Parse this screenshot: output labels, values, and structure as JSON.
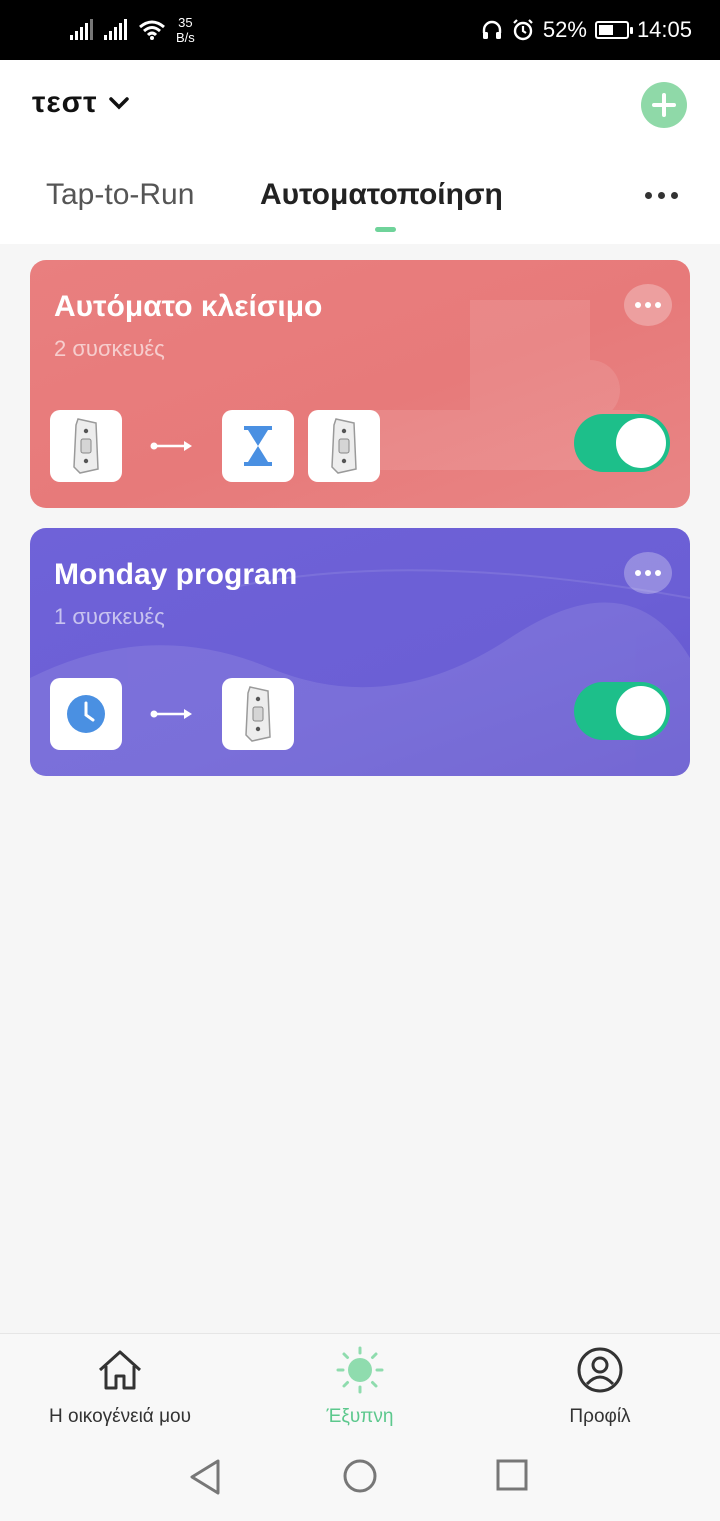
{
  "status_bar": {
    "speed_value": "35",
    "speed_unit": "B/s",
    "battery": "52%",
    "battery_level": 0.52,
    "time": "14:05"
  },
  "header": {
    "home_name": "τεστ",
    "tabs": [
      {
        "label": "Tap-to-Run",
        "active": false
      },
      {
        "label": "Αυτοματοποίηση",
        "active": true
      }
    ],
    "accent_color": "#6fd39a"
  },
  "automations": [
    {
      "title": "Αυτόματο κλείσιμο",
      "subtitle": "2 συσκευές",
      "enabled": true,
      "color": "#e97f7f",
      "condition_icons": [
        "relay-device-icon"
      ],
      "action_icons": [
        "hourglass-icon",
        "relay-device-icon"
      ]
    },
    {
      "title": "Monday program",
      "subtitle": "1 συσκευές",
      "enabled": true,
      "color": "#6b5fd5",
      "condition_icons": [
        "clock-icon"
      ],
      "action_icons": [
        "relay-device-icon"
      ]
    }
  ],
  "bottom_nav": [
    {
      "label": "Η οικογένειά μου",
      "icon": "home-icon",
      "active": false
    },
    {
      "label": "Έξυπνη",
      "icon": "sun-icon",
      "active": true
    },
    {
      "label": "Προφίλ",
      "icon": "profile-icon",
      "active": false
    }
  ],
  "toggle_color": "#1dbf8a"
}
